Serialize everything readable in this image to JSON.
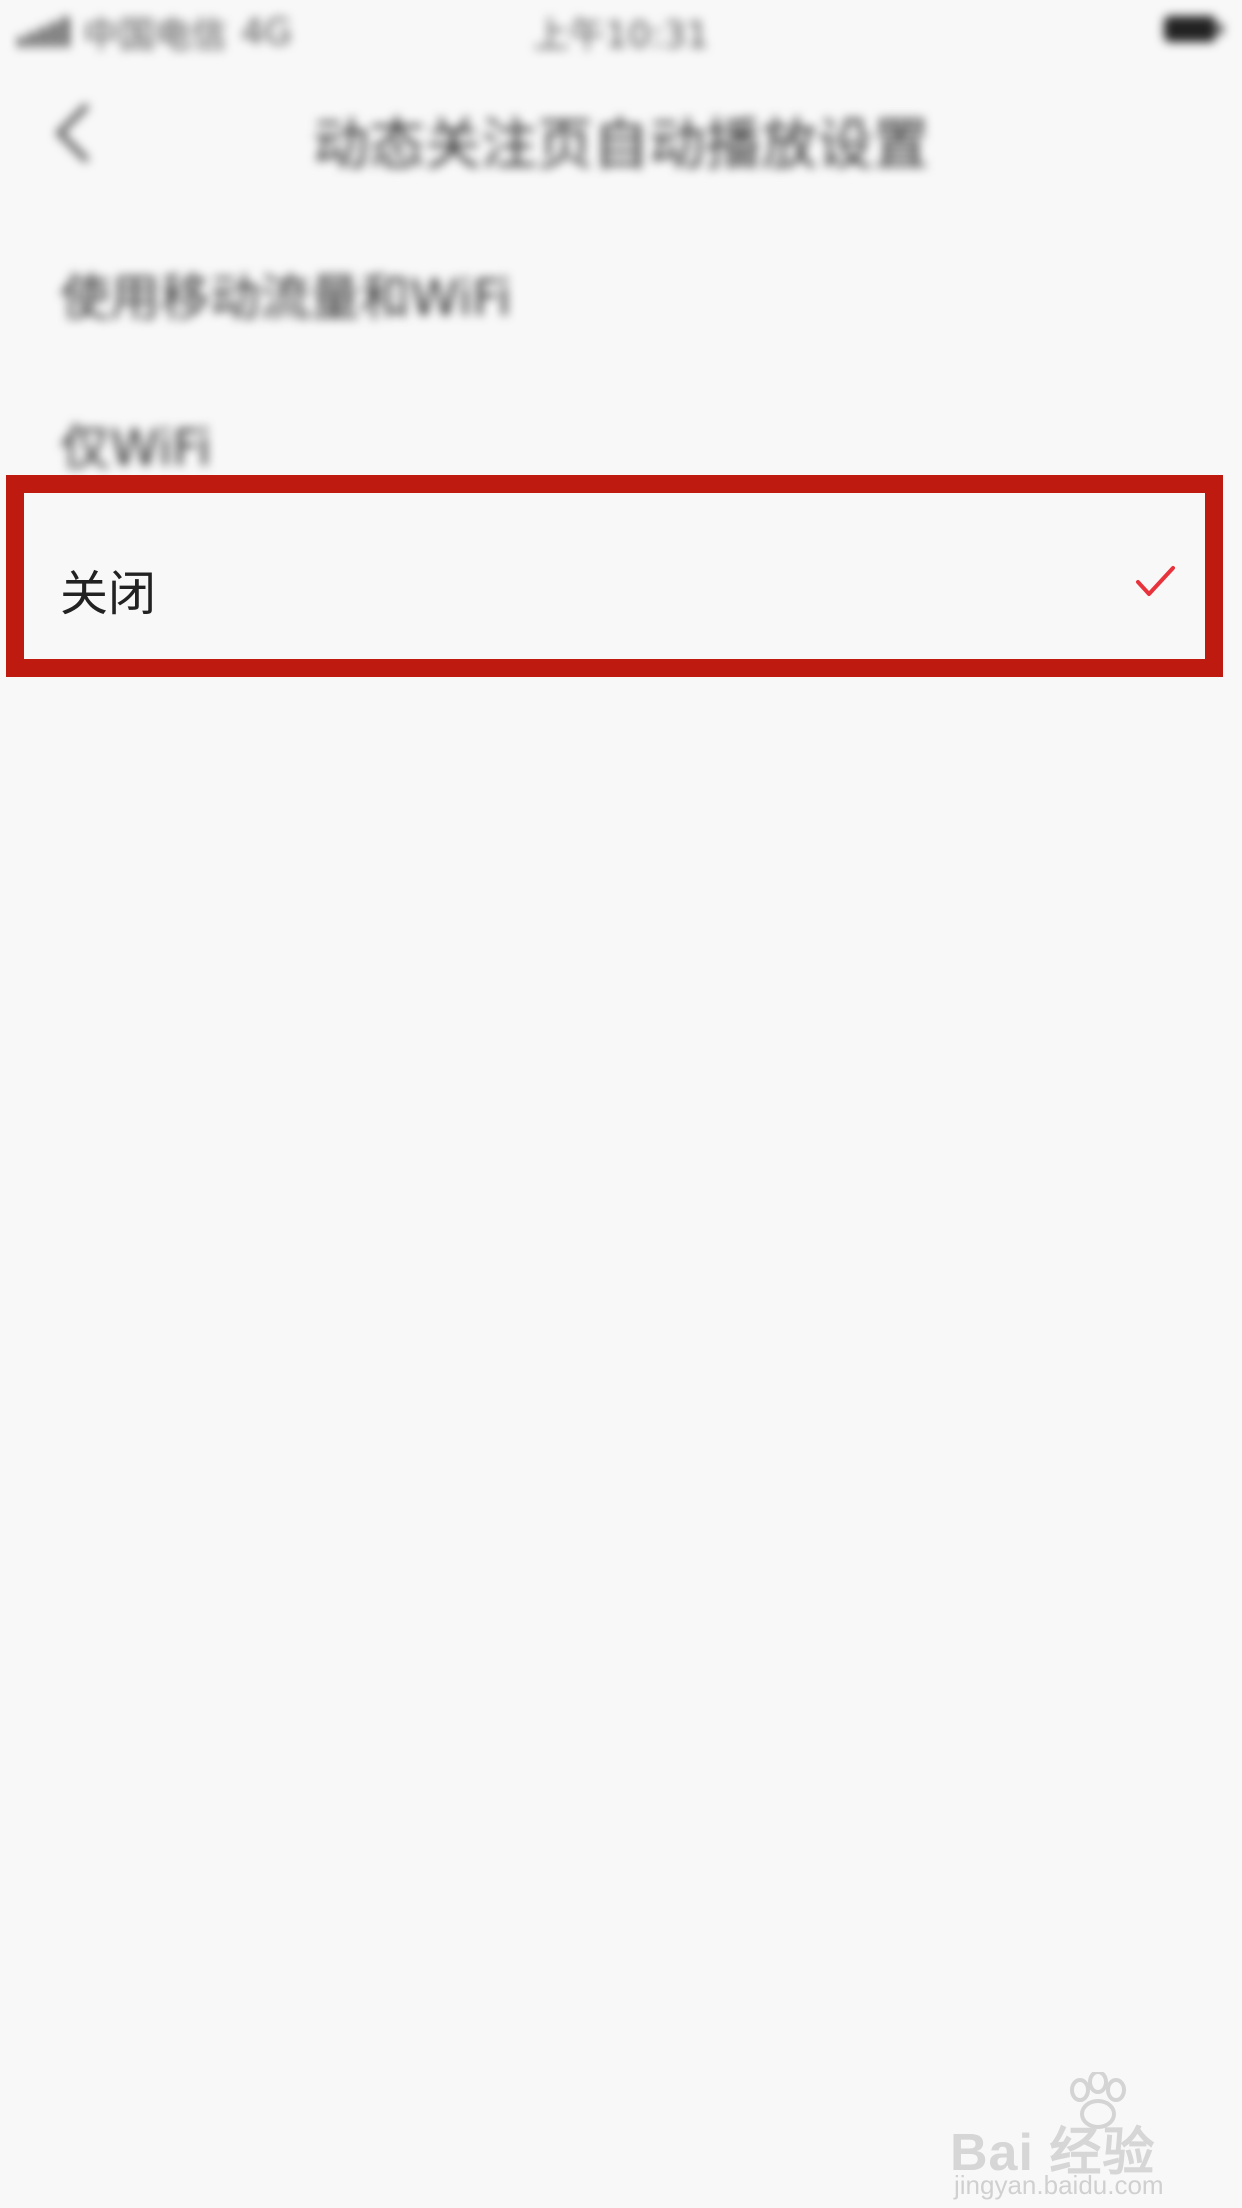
{
  "status_bar": {
    "carrier": "中国电信",
    "network": "4G",
    "time": "上午10:31"
  },
  "nav": {
    "title": "动态关注页自动播放设置"
  },
  "options": [
    {
      "label": "使用移动流量和WiFi",
      "selected": false
    },
    {
      "label": "仅WiFi",
      "selected": false
    },
    {
      "label": "关闭",
      "selected": true
    }
  ],
  "colors": {
    "highlight_border": "#bf1a10",
    "check": "#e8323c",
    "background": "#f8f8f8"
  },
  "icons": {
    "back": "chevron-left-icon",
    "check": "checkmark-icon",
    "battery": "battery-icon",
    "signal": "signal-icon"
  },
  "watermark": {
    "brand": "Bai 经验",
    "url": "jingyan.baidu.com"
  }
}
